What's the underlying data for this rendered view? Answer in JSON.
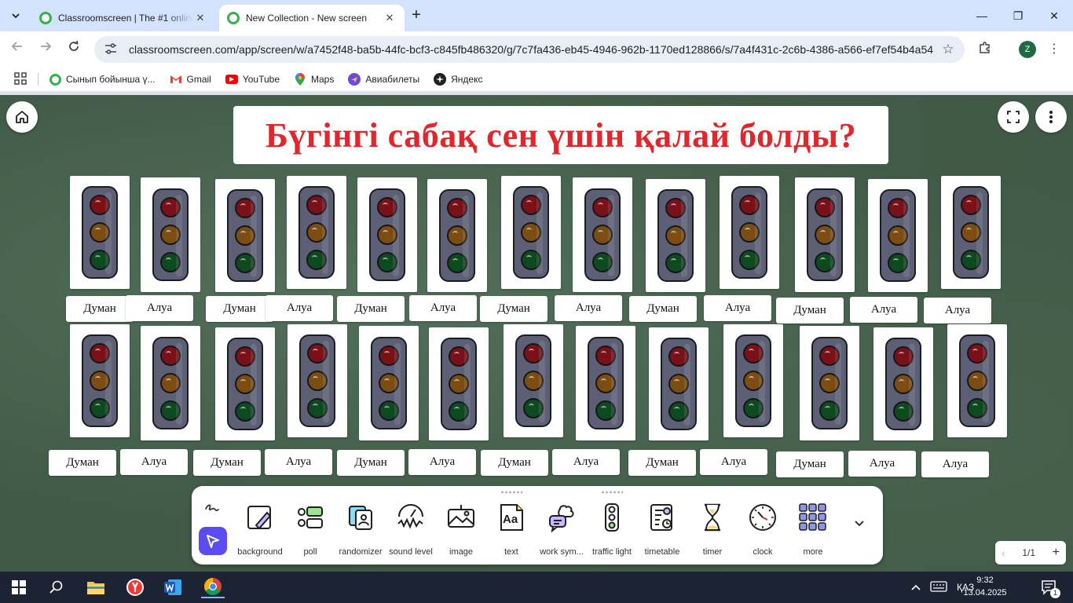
{
  "browser": {
    "tabs": [
      {
        "title": "Classroomscreen | The #1 online",
        "active": false
      },
      {
        "title": "New Collection - New screen",
        "active": true
      }
    ],
    "url": "classroomscreen.com/app/screen/w/a7452f48-ba5b-44fc-bcf3-c845fb486320/g/7c7fa436-eb45-4946-962b-1170ed128866/s/7a4f431c-2c6b-4386-a566-ef7ef54b4a54",
    "profile_initial": "Z",
    "bookmarks": [
      {
        "label": "Сынып бойынша ү...",
        "icon": "classroomscreen-icon"
      },
      {
        "label": "Gmail",
        "icon": "gmail-icon"
      },
      {
        "label": "YouTube",
        "icon": "youtube-icon"
      },
      {
        "label": "Maps",
        "icon": "maps-icon"
      },
      {
        "label": "Авиабилеты",
        "icon": "aviatickets-icon"
      },
      {
        "label": "Яндекс",
        "icon": "yandex-icon"
      }
    ]
  },
  "screen": {
    "title": "Бүгінгі сабақ сен үшін қалай болды?",
    "row1_names": [
      "Думан",
      "Алуа",
      "Думан",
      "Алуа",
      "Думан",
      "Алуа",
      "Думан",
      "Алуа",
      "Думан",
      "Алуа",
      "Думан",
      "Алуа",
      "Алуа"
    ],
    "row2_names": [
      "Думан",
      "Алуа",
      "Думан",
      "Алуа",
      "Думан",
      "Алуа",
      "Думан",
      "Алуа",
      "Думан",
      "Алуа",
      "Думан",
      "Алуа",
      "Алуа"
    ],
    "traffic_light_colors": {
      "red": "#7a1118",
      "amber": "#7b4d13",
      "green": "#0d4a1f"
    },
    "title_color": "#e1262c",
    "accent_color": "#5b4cf0"
  },
  "dock": {
    "items": [
      {
        "label": "background",
        "icon": "background-icon"
      },
      {
        "label": "poll",
        "icon": "poll-icon"
      },
      {
        "label": "randomizer",
        "icon": "randomizer-icon"
      },
      {
        "label": "sound level",
        "icon": "sound-level-icon"
      },
      {
        "label": "image",
        "icon": "image-icon"
      },
      {
        "label": "text",
        "icon": "text-icon"
      },
      {
        "label": "work sym...",
        "icon": "work-symbols-icon"
      },
      {
        "label": "traffic light",
        "icon": "traffic-light-icon"
      },
      {
        "label": "timetable",
        "icon": "timetable-icon"
      },
      {
        "label": "timer",
        "icon": "timer-icon"
      },
      {
        "label": "clock",
        "icon": "clock-icon"
      },
      {
        "label": "more",
        "icon": "more-grid-icon"
      }
    ],
    "text_icon_label": "Aa"
  },
  "pager": {
    "current": "1/1"
  },
  "taskbar": {
    "language": "ҚАЗ",
    "time": "9:32",
    "date": "13.04.2025",
    "notifications": "1"
  }
}
